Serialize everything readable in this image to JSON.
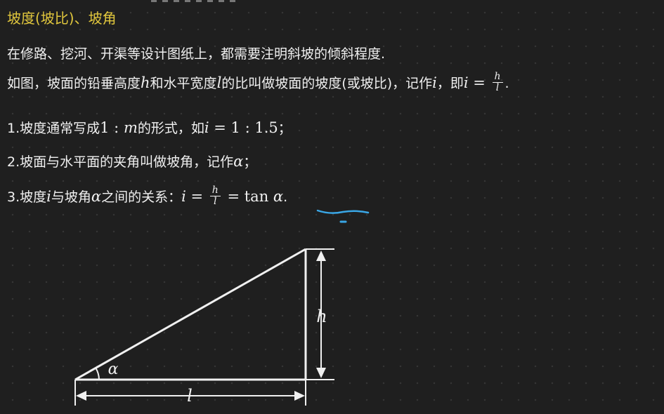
{
  "title": "坡度(坡比)、坡角",
  "intro": "在修路、挖河、开渠等设计图纸上，都需要注明斜坡的倾斜程度.",
  "definition": {
    "prefix": "如图，坡面的铅垂高度",
    "var_h": "h",
    "mid1": "和水平宽度",
    "var_l": "l",
    "mid2": "的比叫做坡面的坡度(或坡比)，记作",
    "var_i": "i",
    "mid3": "，即",
    "eq_lhs": "i",
    "eq_sign": " = ",
    "frac_num": "h",
    "frac_den": "l",
    "end": "."
  },
  "item1": {
    "prefix": "1.坡度通常写成",
    "ratio": "1 : ",
    "var_m": "m",
    "mid": "的形式，如",
    "var_i": "i",
    "value": " = 1 : 1.5",
    "end": "；"
  },
  "item2": {
    "prefix": "2.坡面与水平面的夹角叫做坡角，记作",
    "var_alpha": "α",
    "end": "；"
  },
  "item3": {
    "prefix": "3.坡度",
    "var_i": "i",
    "mid1": "与坡角",
    "var_alpha": "α",
    "mid2": "之间的关系：",
    "eq_lhs": "i",
    "eq_sign": " = ",
    "frac_num": "h",
    "frac_den": "l",
    "eq_sign2": " = ",
    "tan": "tan",
    "tan_var": " α",
    "end": "."
  },
  "diagram": {
    "label_h": "h",
    "label_l": "l",
    "label_alpha": "α"
  },
  "colors": {
    "title": "#e0c63d",
    "text": "#f0f0f0",
    "annotation": "#3aa7e6"
  }
}
